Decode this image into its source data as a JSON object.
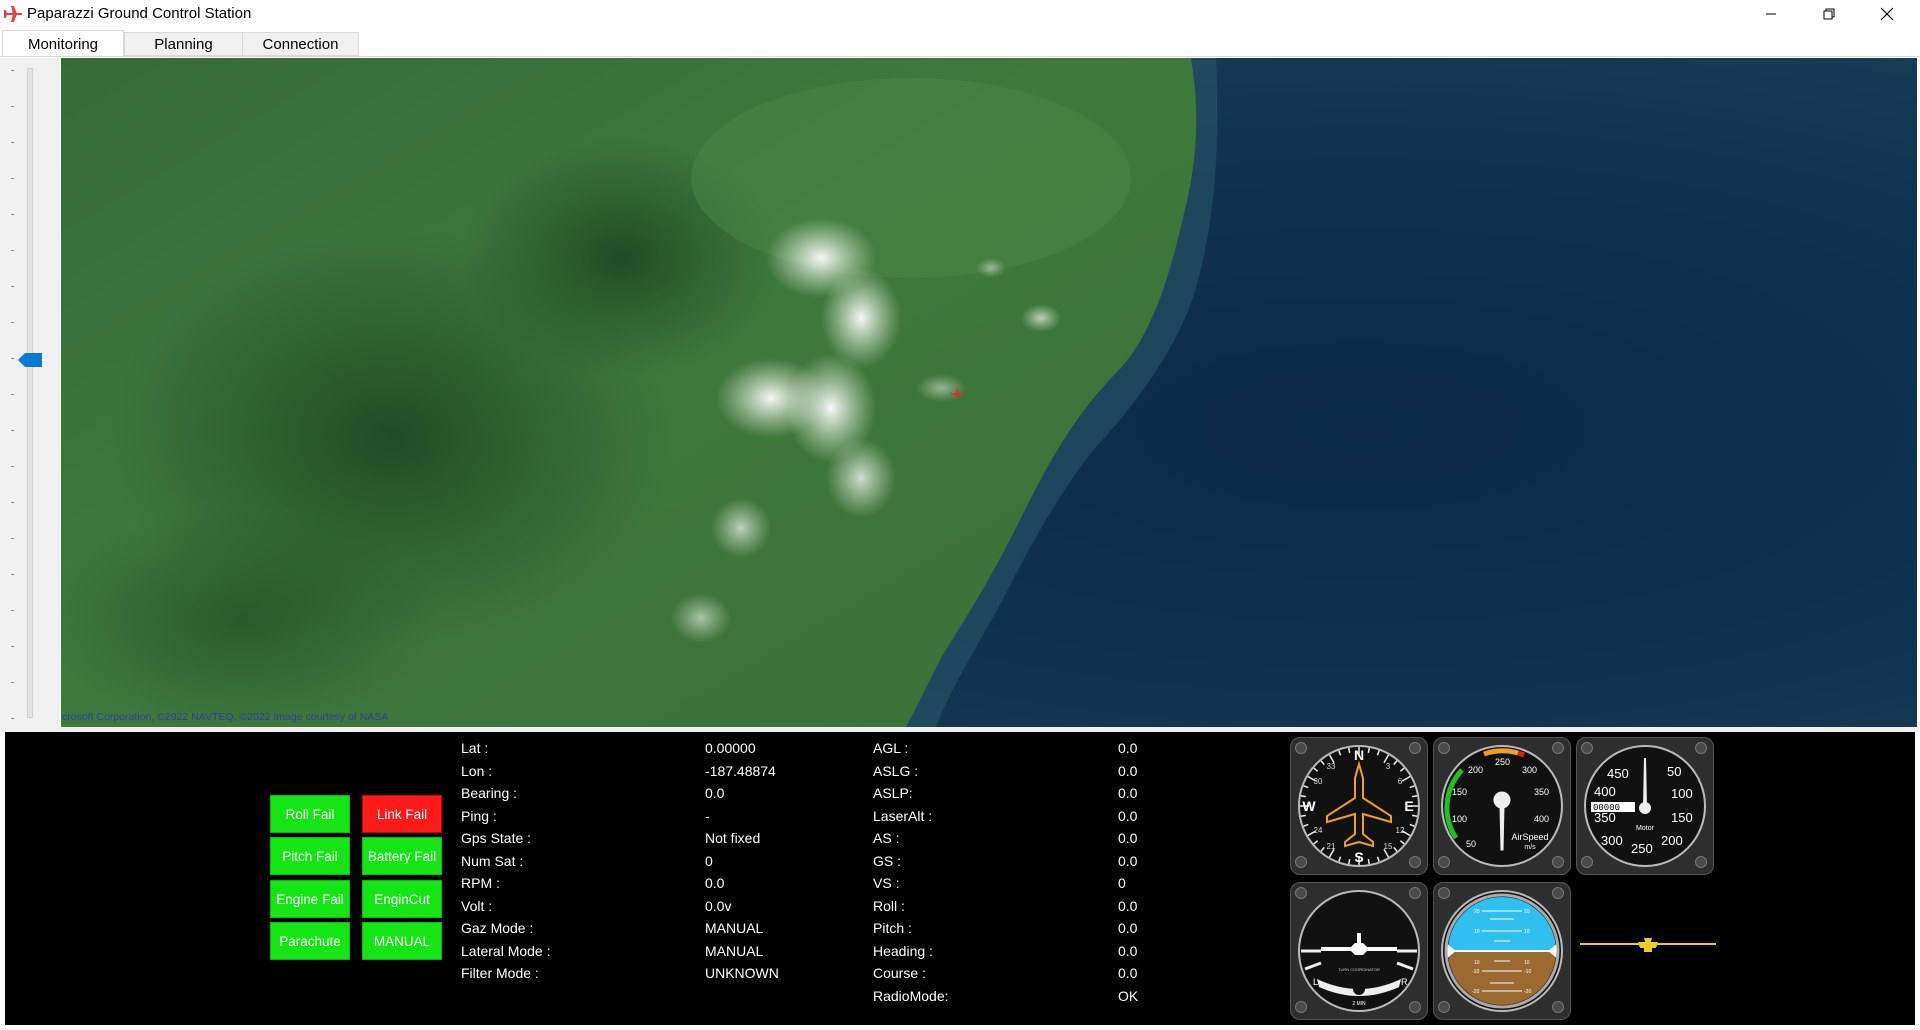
{
  "window": {
    "title": "Paparazzi Ground Control Station",
    "accent_color": "#e84040"
  },
  "tabs": [
    {
      "label": "Monitoring",
      "active": true
    },
    {
      "label": "Planning",
      "active": false
    },
    {
      "label": "Connection",
      "active": false
    }
  ],
  "map": {
    "attribution": "crosoft Corporation, ©2022 NAVTEQ, ©2022 Image courtesy of NASA",
    "zoom_level_fraction": 0.45
  },
  "failure_buttons": {
    "roll_fail": "Roll Fail",
    "link_fail": "Link Fail",
    "pitch_fail": "Pitch Fail",
    "battery_fail": "Battery Fail",
    "engine_fail": "Engine Fail",
    "engin_cut": "EnginCut",
    "parachute": "Parachute",
    "manual": "MANUAL",
    "ok_color": "#15e515",
    "fail_color": "#ff1a1a"
  },
  "telemetry_left": [
    {
      "label": "Lat :",
      "value": "0.00000"
    },
    {
      "label": "Lon :",
      "value": "-187.48874"
    },
    {
      "label": "Bearing :",
      "value": "0.0"
    },
    {
      "label": "Ping :",
      "value": "-"
    },
    {
      "label": "Gps State :",
      "value": "Not fixed"
    },
    {
      "label": "Num Sat :",
      "value": "0"
    },
    {
      "label": "RPM :",
      "value": "0.0"
    },
    {
      "label": "Volt :",
      "value": "0.0v"
    },
    {
      "label": "Gaz Mode :",
      "value": "MANUAL"
    },
    {
      "label": "Lateral Mode :",
      "value": "MANUAL"
    },
    {
      "label": "Filter Mode :",
      "value": "UNKNOWN"
    }
  ],
  "telemetry_right": [
    {
      "label": "AGL :",
      "value": "0.0"
    },
    {
      "label": "ASLG :",
      "value": "0.0"
    },
    {
      "label": "ASLP:",
      "value": "0.0"
    },
    {
      "label": "LaserAlt :",
      "value": "0.0"
    },
    {
      "label": "AS :",
      "value": "0.0"
    },
    {
      "label": "GS :",
      "value": "0.0"
    },
    {
      "label": "VS :",
      "value": "0"
    },
    {
      "label": "Roll :",
      "value": "0.0"
    },
    {
      "label": "Pitch :",
      "value": "0.0"
    },
    {
      "label": "Heading :",
      "value": "0.0"
    },
    {
      "label": "Course :",
      "value": "0.0"
    },
    {
      "label": "RadioMode:",
      "value": "OK"
    }
  ],
  "gauges": {
    "compass": {
      "n": "N",
      "e": "E",
      "s": "S",
      "w": "W",
      "ticks": [
        "33",
        "3",
        "6",
        "12",
        "15",
        "21",
        "24",
        "30"
      ]
    },
    "airspeed": {
      "label": "AirSpeed",
      "unit": "m/s",
      "ticks": [
        "50",
        "100",
        "150",
        "200",
        "250",
        "300",
        "350",
        "400"
      ]
    },
    "motor": {
      "label": "Motor",
      "ticks": [
        "450",
        "50",
        "400",
        "100",
        "350",
        "150",
        "300",
        "250",
        "200"
      ],
      "counter": "00000"
    },
    "turn_coordinator": {
      "left": "L",
      "right": "R",
      "label": "2 MIN",
      "sub": "TURN COORDINATOR"
    },
    "attitude": {
      "ticks": [
        "20",
        "10",
        "10",
        "-10",
        "-20",
        "20",
        "10",
        "10",
        "-10",
        "-20"
      ],
      "sky_color": "#2fc0f0",
      "ground_color": "#9a6a30"
    }
  }
}
